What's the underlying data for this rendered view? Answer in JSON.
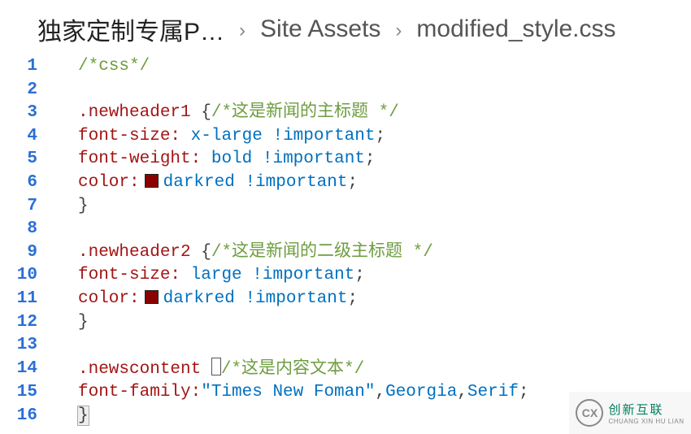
{
  "breadcrumb": {
    "item1": "独家定制专属P…",
    "item2": "Site Assets",
    "item3": "modified_style.css"
  },
  "code": {
    "line1": {
      "comment": "/*css*/"
    },
    "line3": {
      "selector": ".newheader1",
      "brace": "{",
      "comment": "/*这是新闻的主标题 */"
    },
    "line4": {
      "prop": "font-size:",
      "val": "x-large",
      "imp": "!important",
      "semi": ";"
    },
    "line5": {
      "prop": "font-weight:",
      "val": "bold",
      "imp": "!important",
      "semi": ";"
    },
    "line6": {
      "prop": "color:",
      "val": "darkred",
      "imp": "!important",
      "semi": ";",
      "swatch": "#8B0000"
    },
    "line7": {
      "brace": "}"
    },
    "line9": {
      "selector": ".newheader2",
      "brace": "{",
      "comment": "/*这是新闻的二级主标题 */"
    },
    "line10": {
      "prop": "font-size:",
      "val": "large",
      "imp": "!important",
      "semi": ";"
    },
    "line11": {
      "prop": "color:",
      "val": "darkred",
      "imp": "!important",
      "semi": ";",
      "swatch": "#8B0000"
    },
    "line12": {
      "brace": "}"
    },
    "line14": {
      "selector": ".newscontent",
      "brace": "{",
      "comment": "/*这是内容文本*/"
    },
    "line15": {
      "prop": "font-family:",
      "str": "\"Times New Foman\"",
      "v1": "Georgia",
      "v2": "Serif",
      "semi": ";"
    },
    "line16": {
      "brace": "}"
    }
  },
  "line_numbers": [
    "1",
    "2",
    "3",
    "4",
    "5",
    "6",
    "7",
    "8",
    "9",
    "10",
    "11",
    "12",
    "13",
    "14",
    "15",
    "16"
  ],
  "logo": {
    "cn": "创新互联",
    "en": "CHUANG XIN HU LIAN",
    "mark": "CX"
  }
}
